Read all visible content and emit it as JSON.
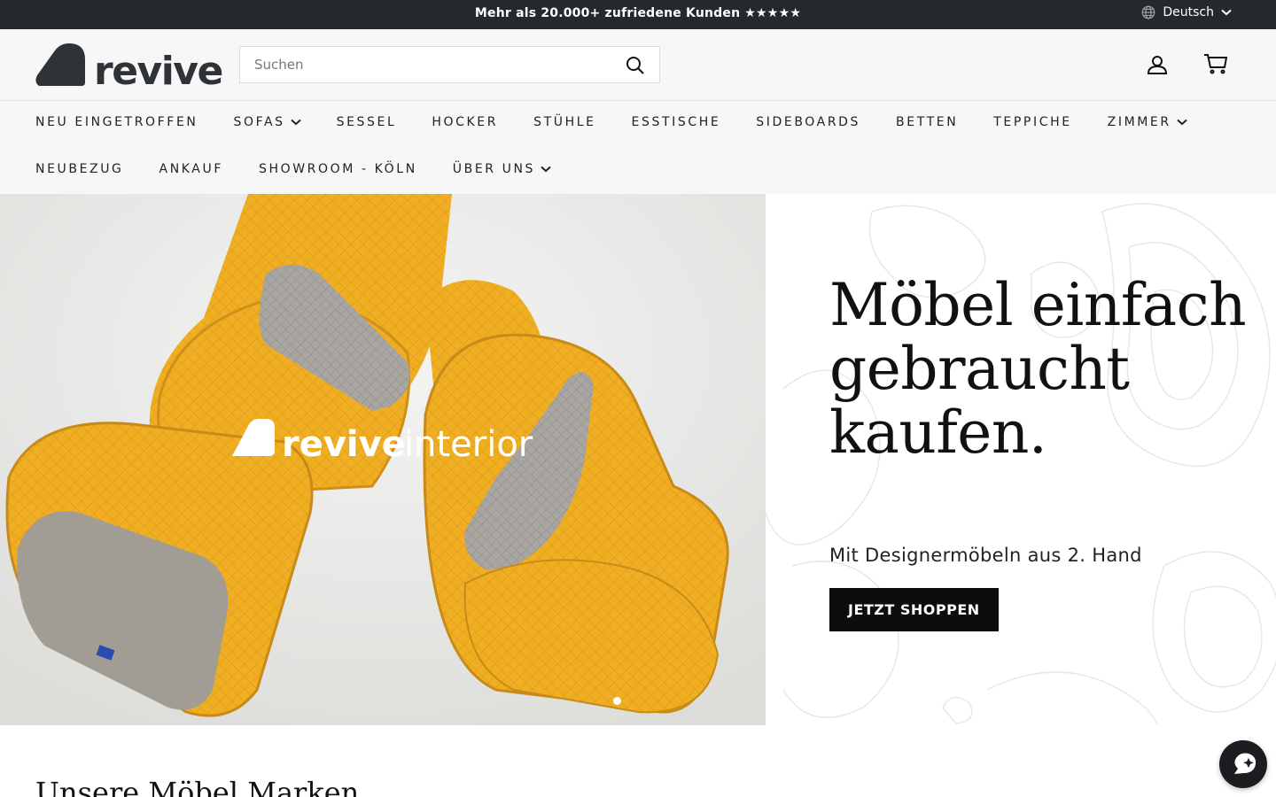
{
  "announcement": {
    "text": "Mehr als 20.000+ zufriedene Kunden ★★★★★"
  },
  "language": {
    "label": "Deutsch"
  },
  "header": {
    "logo_text": "revive",
    "search_placeholder": "Suchen"
  },
  "nav": {
    "row1": [
      {
        "label": "NEU EINGETROFFEN",
        "dropdown": false
      },
      {
        "label": "SOFAS",
        "dropdown": true
      },
      {
        "label": "SESSEL",
        "dropdown": false
      },
      {
        "label": "HOCKER",
        "dropdown": false
      },
      {
        "label": "STÜHLE",
        "dropdown": false
      },
      {
        "label": "ESSTISCHE",
        "dropdown": false
      },
      {
        "label": "SIDEBOARDS",
        "dropdown": false
      },
      {
        "label": "BETTEN",
        "dropdown": false
      },
      {
        "label": "TEPPICHE",
        "dropdown": false
      },
      {
        "label": "ZIMMER",
        "dropdown": true
      }
    ],
    "row2": [
      {
        "label": "NEUBEZUG",
        "dropdown": false
      },
      {
        "label": "ANKAUF",
        "dropdown": false
      },
      {
        "label": "SHOWROOM - KÖLN",
        "dropdown": false
      },
      {
        "label": "ÜBER UNS",
        "dropdown": true
      }
    ]
  },
  "hero": {
    "image_brand": "revive",
    "image_brand_suffix": "interior",
    "title": "Möbel einfach gebraucht kaufen.",
    "subtitle": "Mit Designermöbeln aus 2. Hand",
    "button": "JETZT SHOPPEN"
  },
  "section": {
    "title": "Unsere Möbel Marken"
  },
  "colors": {
    "announcement_bg": "#25282d",
    "header_bg": "#f7f7f7",
    "accent_yellow": "#f2b02a",
    "button_bg": "#0d0d0d"
  },
  "icons": {
    "globe": "globe-icon",
    "chevron": "chevron-down-icon",
    "search": "search-icon",
    "account": "user-icon",
    "cart": "cart-icon",
    "chat": "chat-icon"
  }
}
